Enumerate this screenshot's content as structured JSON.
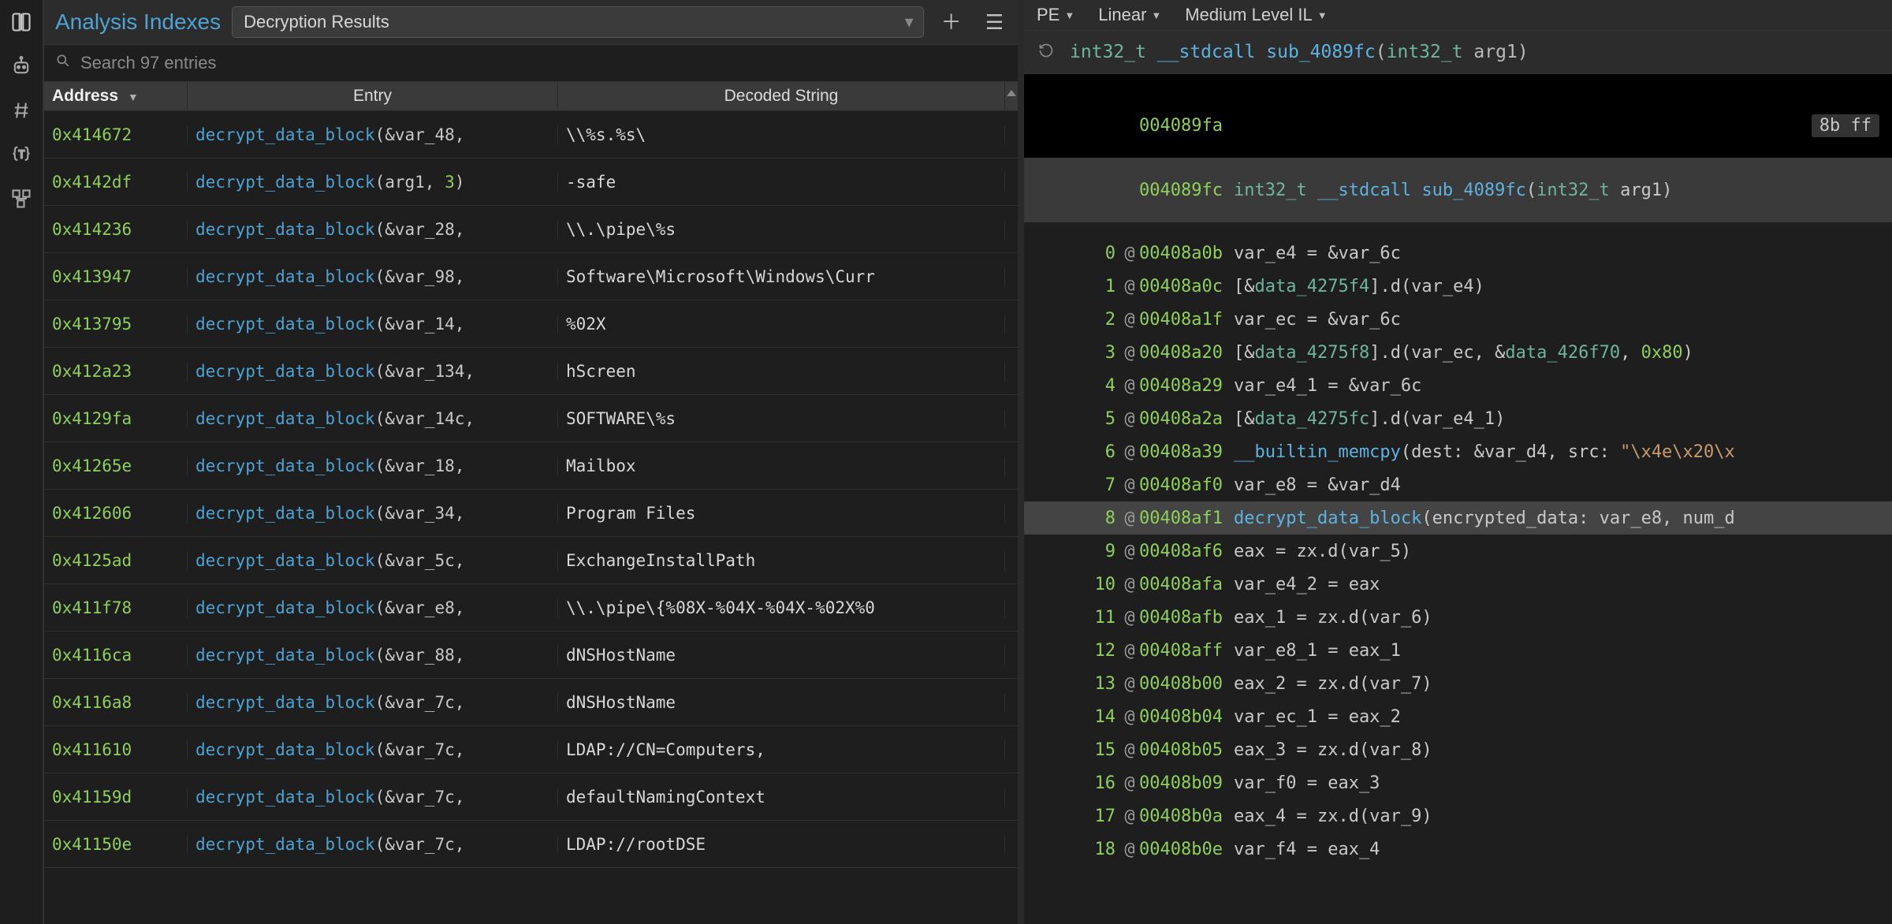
{
  "left": {
    "title": "Analysis Indexes",
    "dropdown_value": "Decryption Results",
    "search_placeholder": "Search 97 entries",
    "columns": {
      "address": "Address",
      "entry": "Entry",
      "decoded": "Decoded String"
    }
  },
  "rows": [
    {
      "addr": "0x414672",
      "fn": "decrypt_data_block",
      "arg1": "&var_48,",
      "decoded": "\\\\%s.%s\\"
    },
    {
      "addr": "0x4142df",
      "fn": "decrypt_data_block",
      "arg1_raw": "arg1, ",
      "arg2_num": "3",
      "arg_close": ")",
      "decoded": "-safe"
    },
    {
      "addr": "0x414236",
      "fn": "decrypt_data_block",
      "arg1": "&var_28,",
      "decoded": "\\\\.\\pipe\\%s"
    },
    {
      "addr": "0x413947",
      "fn": "decrypt_data_block",
      "arg1": "&var_98,",
      "decoded": "Software\\Microsoft\\Windows\\Curr"
    },
    {
      "addr": "0x413795",
      "fn": "decrypt_data_block",
      "arg1": "&var_14,",
      "decoded": "%02X"
    },
    {
      "addr": "0x412a23",
      "fn": "decrypt_data_block",
      "arg1": "&var_134,",
      "decoded": "hScreen"
    },
    {
      "addr": "0x4129fa",
      "fn": "decrypt_data_block",
      "arg1": "&var_14c,",
      "decoded": "SOFTWARE\\%s"
    },
    {
      "addr": "0x41265e",
      "fn": "decrypt_data_block",
      "arg1": "&var_18,",
      "decoded": "Mailbox"
    },
    {
      "addr": "0x412606",
      "fn": "decrypt_data_block",
      "arg1": "&var_34,",
      "decoded": "Program Files"
    },
    {
      "addr": "0x4125ad",
      "fn": "decrypt_data_block",
      "arg1": "&var_5c,",
      "decoded": "ExchangeInstallPath"
    },
    {
      "addr": "0x411f78",
      "fn": "decrypt_data_block",
      "arg1": "&var_e8,",
      "decoded": "\\\\.\\pipe\\{%08X-%04X-%04X-%02X%0"
    },
    {
      "addr": "0x4116ca",
      "fn": "decrypt_data_block",
      "arg1": "&var_88,",
      "decoded": "dNSHostName"
    },
    {
      "addr": "0x4116a8",
      "fn": "decrypt_data_block",
      "arg1": "&var_7c,",
      "decoded": "dNSHostName"
    },
    {
      "addr": "0x411610",
      "fn": "decrypt_data_block",
      "arg1": "&var_7c,",
      "decoded": "LDAP://CN=Computers,"
    },
    {
      "addr": "0x41159d",
      "fn": "decrypt_data_block",
      "arg1": "&var_7c,",
      "decoded": "defaultNamingContext"
    },
    {
      "addr": "0x41150e",
      "fn": "decrypt_data_block",
      "arg1": "&var_7c,",
      "decoded": "LDAP://rootDSE"
    }
  ],
  "right": {
    "modes": [
      "PE",
      "Linear",
      "Medium Level IL"
    ],
    "sig": {
      "ret": "int32_t",
      "cc": "__stdcall",
      "name": "sub_4089fc",
      "arg_type": "int32_t",
      "arg_name": "arg1"
    },
    "top_addr": "004089fa",
    "top_opcode": "8b ff",
    "func_addr": "004089fc"
  },
  "code": [
    {
      "i": "0",
      "addr": "00408a0b",
      "html": "var_e4 = &var_6c"
    },
    {
      "i": "1",
      "addr": "00408a0c",
      "html": "[&<span class='teal'>data_4275f4</span>].d(var_e4)"
    },
    {
      "i": "2",
      "addr": "00408a1f",
      "html": "var_ec = &var_6c"
    },
    {
      "i": "3",
      "addr": "00408a20",
      "html": "[&<span class='teal'>data_4275f8</span>].d(var_ec, &<span class='teal'>data_426f70</span>, <span class='num'>0x80</span>)"
    },
    {
      "i": "4",
      "addr": "00408a29",
      "html": "var_e4_1 = &var_6c"
    },
    {
      "i": "5",
      "addr": "00408a2a",
      "html": "[&<span class='teal'>data_4275fc</span>].d(var_e4_1)"
    },
    {
      "i": "6",
      "addr": "00408a39",
      "html": "<span class='fn'>__builtin_memcpy</span>(dest: &var_d4, src: <span class='str'>\"\\x4e\\x20\\x</span>"
    },
    {
      "i": "7",
      "addr": "00408af0",
      "html": "var_e8 = &var_d4"
    },
    {
      "i": "8",
      "addr": "00408af1",
      "sel": true,
      "html": "<span class='fn'>decrypt_data_block</span>(encrypted_data: var_e8, num_d"
    },
    {
      "i": "9",
      "addr": "00408af6",
      "html": "eax = zx.d(var_5)"
    },
    {
      "i": "10",
      "addr": "00408afa",
      "html": "var_e4_2 = eax"
    },
    {
      "i": "11",
      "addr": "00408afb",
      "html": "eax_1 = zx.d(var_6)"
    },
    {
      "i": "12",
      "addr": "00408aff",
      "html": "var_e8_1 = eax_1"
    },
    {
      "i": "13",
      "addr": "00408b00",
      "html": "eax_2 = zx.d(var_7)"
    },
    {
      "i": "14",
      "addr": "00408b04",
      "html": "var_ec_1 = eax_2"
    },
    {
      "i": "15",
      "addr": "00408b05",
      "html": "eax_3 = zx.d(var_8)"
    },
    {
      "i": "16",
      "addr": "00408b09",
      "html": "var_f0 = eax_3"
    },
    {
      "i": "17",
      "addr": "00408b0a",
      "html": "eax_4 = zx.d(var_9)"
    },
    {
      "i": "18",
      "addr": "00408b0e",
      "html": "var_f4 = eax_4"
    }
  ]
}
